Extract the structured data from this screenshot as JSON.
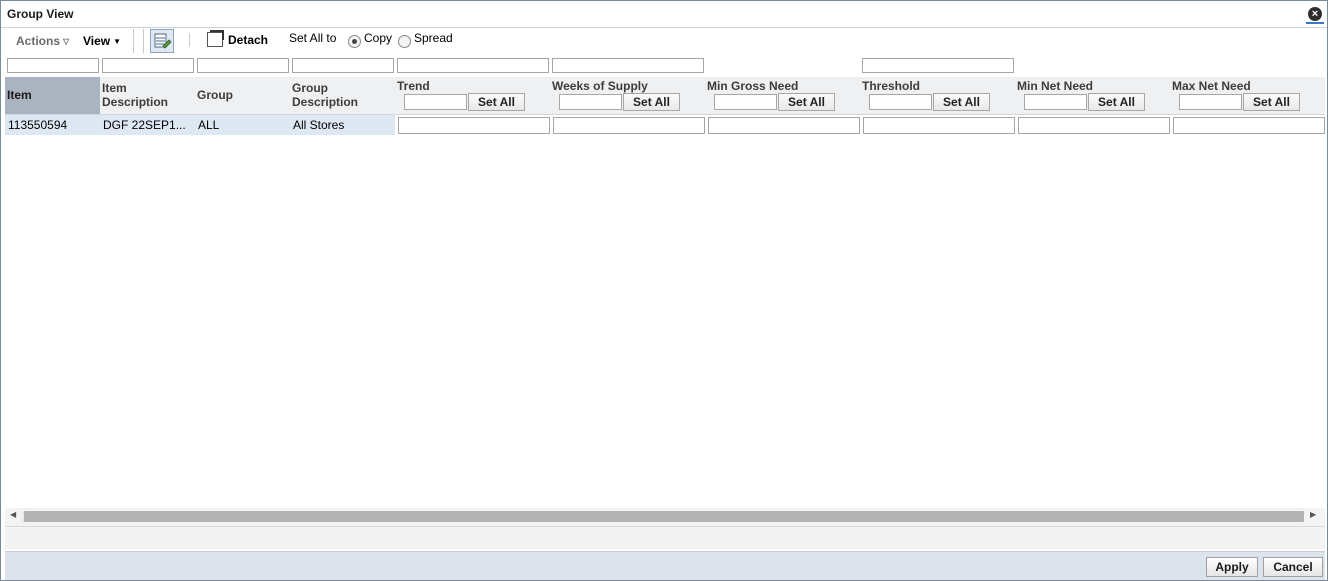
{
  "window": {
    "title": "Group View"
  },
  "toolbar": {
    "actions_label": "Actions",
    "view_label": "View",
    "detach_label": "Detach",
    "set_all_to_label": "Set All to",
    "radio_copy_label": "Copy",
    "radio_spread_label": "Spread",
    "selected_mode": "Copy"
  },
  "columns": {
    "item": "Item",
    "item_description": "Item Description",
    "group": "Group",
    "group_description": "Group Description",
    "editable": [
      {
        "label": "Trend",
        "button": "Set All"
      },
      {
        "label": "Weeks of Supply",
        "button": "Set All"
      },
      {
        "label": "Min Gross Need",
        "button": "Set All"
      },
      {
        "label": "Threshold",
        "button": "Set All"
      },
      {
        "label": "Min Net Need",
        "button": "Set All"
      },
      {
        "label": "Max Net Need",
        "button": "Set All"
      }
    ]
  },
  "rows": [
    {
      "item": "113550594",
      "item_description": "DGF 22SEP1...",
      "group": "ALL",
      "group_description": "All Stores"
    }
  ],
  "footer": {
    "apply_label": "Apply",
    "cancel_label": "Cancel"
  }
}
